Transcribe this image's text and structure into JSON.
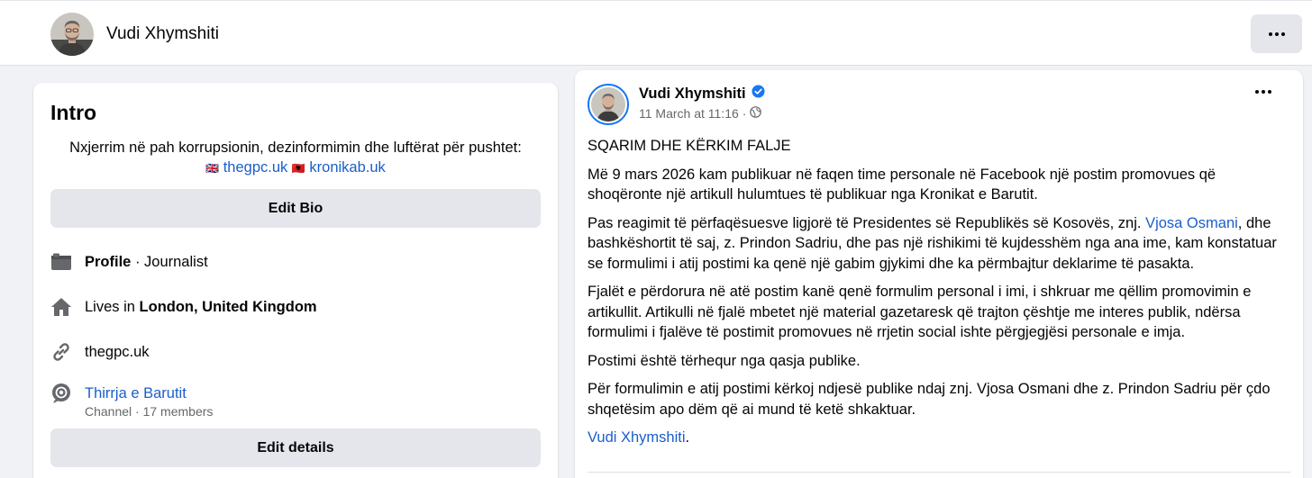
{
  "header": {
    "name": "Vudi Xhymshiti",
    "more_icon": "ellipsis-icon"
  },
  "intro": {
    "title": "Intro",
    "bio_text": "Nxjerrim në pah korrupsionin, dezinformimin dhe luftërat për pushtet:",
    "bio_link_1_flag": "🇬🇧",
    "bio_link_1": "thegpc.uk",
    "bio_link_2_flag": "🇦🇱",
    "bio_link_2": "kronikab.uk",
    "edit_bio_label": "Edit Bio",
    "profile_label": "Profile",
    "profile_sep": " · ",
    "profile_value": "Journalist",
    "lives_prefix": "Lives in ",
    "lives_value": "London, United Kingdom",
    "website": "thegpc.uk",
    "channel_name": "Thirrja e Barutit",
    "channel_sub": "Channel · 17 members",
    "edit_details_label": "Edit details"
  },
  "post": {
    "author": "Vudi Xhymshiti",
    "date": "11 March at 11:16",
    "meta_sep": "·",
    "title": "SQARIM DHE KËRKIM FALJE",
    "p1": "Më 9 mars 2026 kam publikuar në faqen time personale në Facebook një postim promovues që shoqëronte një artikull hulumtues të publikuar nga Kronikat e Barutit.",
    "p2_a": "Pas reagimit të përfaqësuesve ligjorë të Presidentes së Republikës së Kosovës, znj. ",
    "p2_link": "Vjosa Osmani",
    "p2_b": ", dhe bashkëshortit të saj, z. Prindon Sadriu, dhe pas një rishikimi të kujdesshëm nga ana ime, kam konstatuar se formulimi i atij postimi ka qenë një gabim gjykimi dhe ka përmbajtur deklarime të pasakta.",
    "p3": "Fjalët e përdorura në atë postim kanë qenë formulim personal i imi, i shkruar me qëllim promovimin e artikullit. Artikulli në fjalë mbetet një material gazetaresk që trajton çështje me interes publik, ndërsa formulimi i fjalëve të postimit promovues në rrjetin social ishte përgjegjësi personale e imja.",
    "p4": "Postimi është tërhequr nga qasja publike.",
    "p5": "Për formulimin e atij postimi kërkoj ndjesë publike ndaj znj. Vjosa Osmani dhe z. Prindon Sadriu për çdo shqetësim apo dëm që ai mund të ketë shkaktuar.",
    "signature_link": "Vudi Xhymshiti",
    "signature_end": "."
  },
  "colors": {
    "link": "#1a5fc9",
    "verified": "#1877f2",
    "button_bg": "#e4e6eb",
    "page_bg": "#f0f2f5"
  }
}
